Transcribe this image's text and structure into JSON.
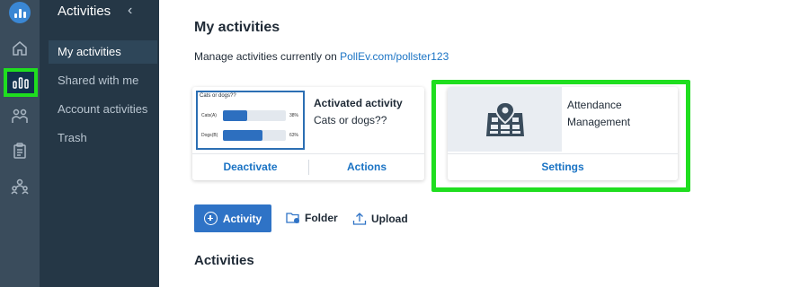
{
  "sidebar": {
    "title": "Activities",
    "collapse_icon": "chevron-left-icon",
    "items": [
      {
        "label": "My activities",
        "selected": true
      },
      {
        "label": "Shared with me",
        "selected": false
      },
      {
        "label": "Account activities",
        "selected": false
      },
      {
        "label": "Trash",
        "selected": false
      }
    ]
  },
  "rail": {
    "icons": [
      "logo-icon",
      "home-icon",
      "activities-icon",
      "participants-icon",
      "reports-icon",
      "groups-icon"
    ],
    "active": "activities-icon",
    "highlight_color": "#1fde1f"
  },
  "main": {
    "title": "My activities",
    "manage_text": "Manage activities currently on ",
    "manage_link": "PollEv.com/pollster123",
    "cards": [
      {
        "status": "Activated activity",
        "name": "Cats or dogs??",
        "thumbnail": {
          "question": "Cats or dogs??",
          "options": [
            {
              "label": "Cats",
              "key": "(A)",
              "percent": "38%",
              "fraction": 0.38
            },
            {
              "label": "Dogs",
              "key": "(B)",
              "percent": "63%",
              "fraction": 0.63
            }
          ]
        },
        "buttons": [
          "Deactivate",
          "Actions"
        ]
      },
      {
        "name": "Attendance Management",
        "icon": "attendance-map-pin-icon",
        "buttons": [
          "Settings"
        ]
      }
    ],
    "toolbar": {
      "add_activity": "Activity",
      "folder": "Folder",
      "upload": "Upload"
    },
    "section_title": "Activities"
  },
  "colors": {
    "accent": "#2f73c6",
    "link": "#1a73c4",
    "highlight": "#1fde1f",
    "sidebar_bg": "#253746",
    "rail_bg": "#3a4c5c"
  }
}
